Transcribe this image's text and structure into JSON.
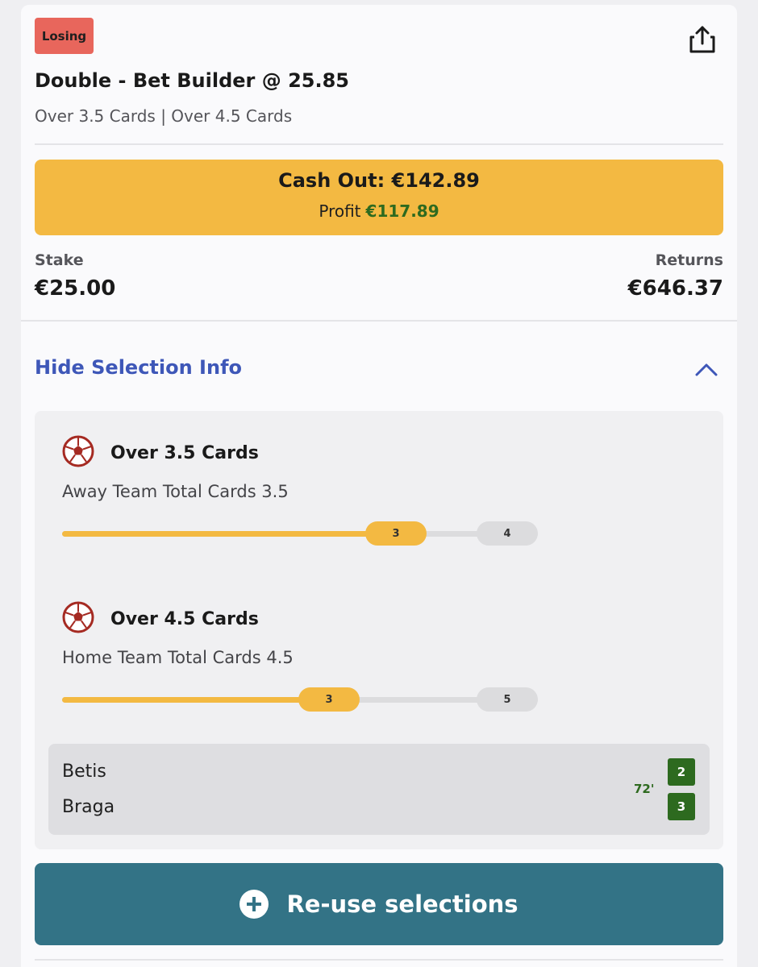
{
  "bet": {
    "status_badge": "Losing",
    "title": "Double - Bet Builder @ 25.85",
    "subtitle": "Over 3.5 Cards | Over 4.5 Cards",
    "share_icon": "share-icon"
  },
  "cashout": {
    "label": "Cash Out: €142.89",
    "profit_label": "Profit",
    "profit_value": "€117.89"
  },
  "stake": {
    "label": "Stake",
    "value": "€25.00"
  },
  "returns": {
    "label": "Returns",
    "value": "€646.37"
  },
  "selection_toggle": {
    "label": "Hide Selection Info",
    "icon": "chevron-up-icon"
  },
  "selections": [
    {
      "title": "Over 3.5 Cards",
      "subtitle": "Away Team Total Cards 3.5",
      "current": "3",
      "target": "4",
      "progress_fraction": 0.75,
      "icon": "football-icon"
    },
    {
      "title": "Over 4.5 Cards",
      "subtitle": "Home Team Total Cards 4.5",
      "current": "3",
      "target": "5",
      "progress_fraction": 0.6,
      "icon": "football-icon"
    }
  ],
  "match": {
    "home_team": "Betis",
    "away_team": "Braga",
    "minute": "72'",
    "home_score": "2",
    "away_score": "3"
  },
  "reuse_button": {
    "label": "Re-use selections",
    "icon": "plus-circle-icon"
  },
  "colors": {
    "losing": "#e8665c",
    "cashout": "#f3b942",
    "profit": "#2e6a1f",
    "link": "#3e57b8",
    "reuse": "#337386"
  }
}
